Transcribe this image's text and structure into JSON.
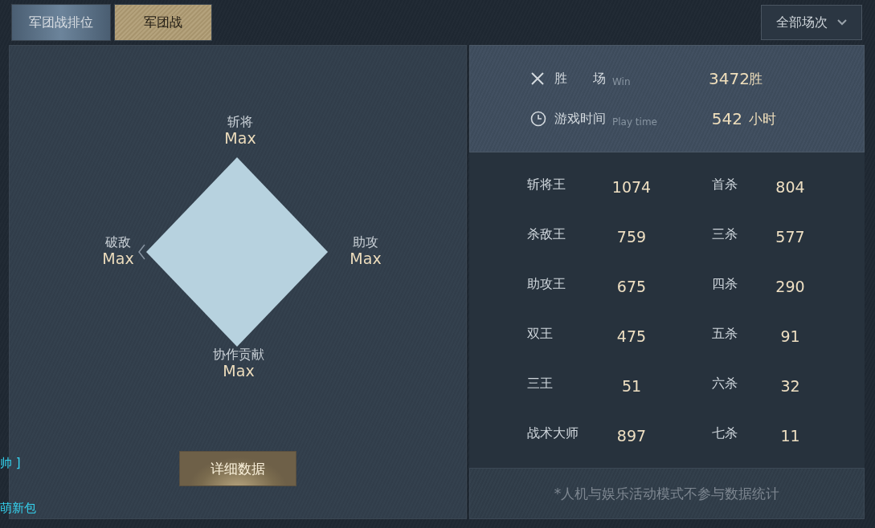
{
  "tabs": [
    {
      "label": "军团战排位",
      "selected": false
    },
    {
      "label": "军团战",
      "selected": true
    }
  ],
  "filter": {
    "label": "全部场次"
  },
  "radar": {
    "axes": [
      {
        "label": "斩将",
        "value": "Max"
      },
      {
        "label": "助攻",
        "value": "Max"
      },
      {
        "label": "协作贡献",
        "value": "Max"
      },
      {
        "label": "破敌",
        "value": "Max"
      }
    ]
  },
  "detail_button": "详细数据",
  "summary": [
    {
      "kind": "wins",
      "label": "胜　　场",
      "hint": "Win",
      "value": "3472",
      "unit": "胜"
    },
    {
      "kind": "time",
      "label": "游戏时间",
      "hint": "Play time",
      "value": "542",
      "unit": "小时"
    }
  ],
  "stats": [
    {
      "label": "斩将王",
      "value": "1074"
    },
    {
      "label": "首杀",
      "value": "804"
    },
    {
      "label": "杀敌王",
      "value": "759"
    },
    {
      "label": "三杀",
      "value": "577"
    },
    {
      "label": "助攻王",
      "value": "675"
    },
    {
      "label": "四杀",
      "value": "290"
    },
    {
      "label": "双王",
      "value": "475"
    },
    {
      "label": "五杀",
      "value": "91"
    },
    {
      "label": "三王",
      "value": "51"
    },
    {
      "label": "六杀",
      "value": "32"
    },
    {
      "label": "战术大师",
      "value": "897"
    },
    {
      "label": "七杀",
      "value": "11"
    }
  ],
  "footnote": "*人机与娱乐活动模式不参与数据统计",
  "edge_texts": [
    "帅 ]",
    "萌新包"
  ]
}
